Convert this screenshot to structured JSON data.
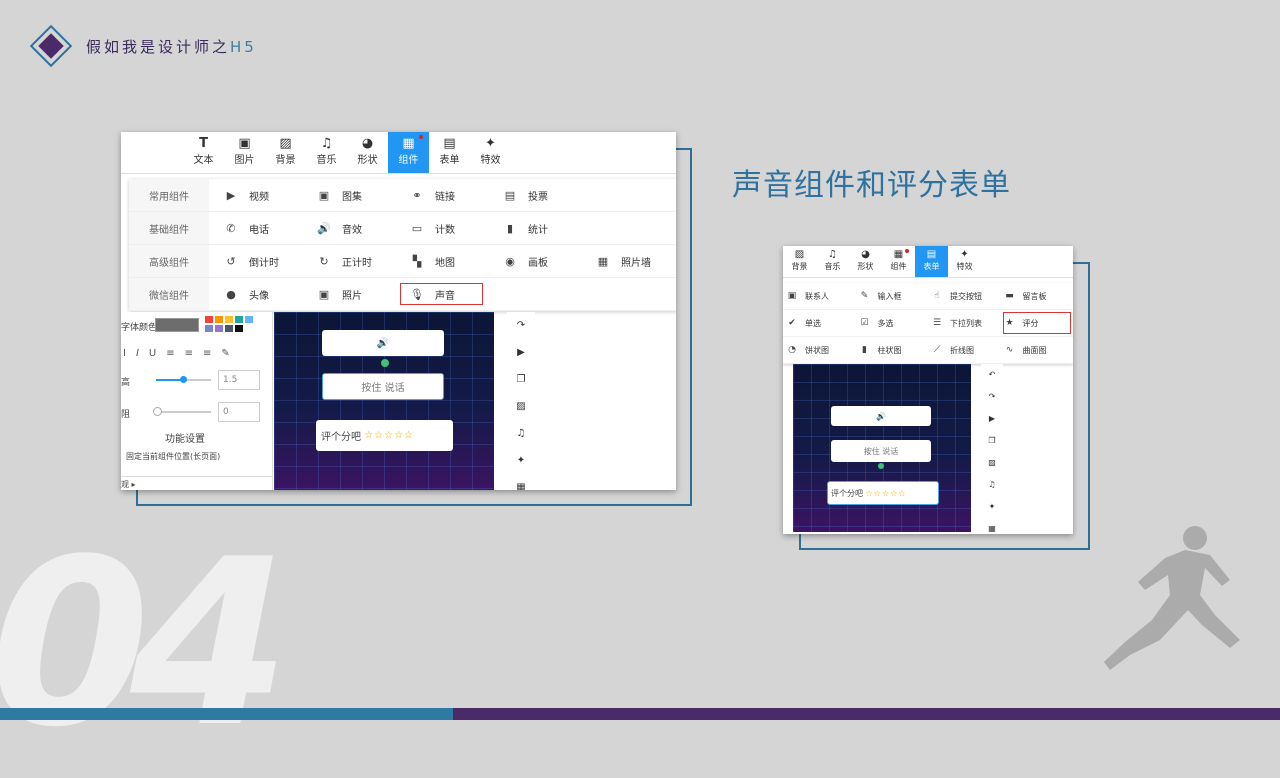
{
  "header": {
    "brand": "假如我是设计师之",
    "brand_suffix": "H5"
  },
  "title": "声音组件和评分表单",
  "bignum": "04",
  "shot1": {
    "toolbar": [
      {
        "icon": "T",
        "label": "文本"
      },
      {
        "icon": "▣",
        "label": "图片"
      },
      {
        "icon": "▨",
        "label": "背景"
      },
      {
        "icon": "♫",
        "label": "音乐"
      },
      {
        "icon": "◕",
        "label": "形状"
      },
      {
        "icon": "▦",
        "label": "组件",
        "active": true
      },
      {
        "icon": "▤",
        "label": "表单"
      },
      {
        "icon": "✦",
        "label": "特效"
      }
    ],
    "menu": [
      {
        "cat": "常用组件",
        "items": [
          {
            "icon": "▶",
            "label": "视频"
          },
          {
            "icon": "▣",
            "label": "图集"
          },
          {
            "icon": "⚭",
            "label": "链接"
          },
          {
            "icon": "▤",
            "label": "投票"
          }
        ]
      },
      {
        "cat": "基础组件",
        "items": [
          {
            "icon": "✆",
            "label": "电话"
          },
          {
            "icon": "🔊",
            "label": "音效"
          },
          {
            "icon": "▭",
            "label": "计数"
          },
          {
            "icon": "▮",
            "label": "统计"
          }
        ]
      },
      {
        "cat": "高级组件",
        "items": [
          {
            "icon": "↺",
            "label": "倒计时"
          },
          {
            "icon": "↻",
            "label": "正计时"
          },
          {
            "icon": "▚",
            "label": "地图"
          },
          {
            "icon": "◉",
            "label": "画板"
          },
          {
            "icon": "▦",
            "label": "照片墙"
          }
        ]
      },
      {
        "cat": "微信组件",
        "items": [
          {
            "icon": "●",
            "label": "头像"
          },
          {
            "icon": "▣",
            "label": "照片"
          },
          {
            "icon": "🎙",
            "label": "声音"
          }
        ]
      }
    ],
    "panel": {
      "color_label": "字体颜色",
      "spacing_val": "1.5",
      "offset_val": "0",
      "section": "功能设置",
      "fix_label": "固定当前组件位置(长页面)",
      "size_label": "高",
      "offset_label": "阻",
      "more": "观"
    },
    "widgets": {
      "sound": "🔊",
      "press": "按住 说话",
      "rate": "评个分吧",
      "stars": "☆☆☆☆☆"
    },
    "sidebar": [
      "↷",
      "▶",
      "❐",
      "▨",
      "♫",
      "✦",
      "▦"
    ]
  },
  "shot2": {
    "toolbar": [
      {
        "icon": "▨",
        "label": "背景"
      },
      {
        "icon": "♫",
        "label": "音乐"
      },
      {
        "icon": "◕",
        "label": "形状"
      },
      {
        "icon": "▦",
        "label": "组件"
      },
      {
        "icon": "▤",
        "label": "表单",
        "active": true
      },
      {
        "icon": "✦",
        "label": "特效"
      }
    ],
    "menu": [
      [
        {
          "icon": "▣",
          "label": "联系人"
        },
        {
          "icon": "✎",
          "label": "输入框"
        },
        {
          "icon": "☝",
          "label": "提交按钮"
        },
        {
          "icon": "▬",
          "label": "留言板"
        }
      ],
      [
        {
          "icon": "✔",
          "label": "单选"
        },
        {
          "icon": "☑",
          "label": "多选"
        },
        {
          "icon": "☰",
          "label": "下拉列表"
        },
        {
          "icon": "★",
          "label": "评分"
        }
      ],
      [
        {
          "icon": "◔",
          "label": "饼状图"
        },
        {
          "icon": "▮",
          "label": "柱状图"
        },
        {
          "icon": "⟋",
          "label": "折线图"
        },
        {
          "icon": "∿",
          "label": "曲面图"
        }
      ]
    ],
    "widgets": {
      "sound": "🔊",
      "press": "按住 说话",
      "rate": "评个分吧",
      "stars": "☆☆☆☆☆"
    },
    "sidebar": [
      "↶",
      "↷",
      "▶",
      "❐",
      "▨",
      "♫",
      "✦",
      "▦"
    ]
  }
}
